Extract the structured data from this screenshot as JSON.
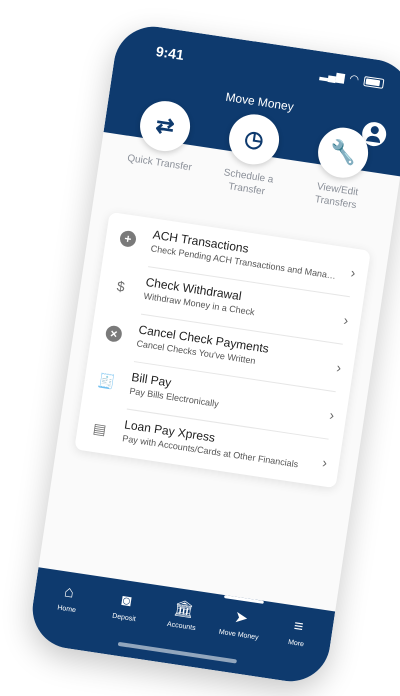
{
  "status": {
    "time": "9:41"
  },
  "header": {
    "title": "Move Money"
  },
  "quick_actions": [
    {
      "label": "Quick Transfer",
      "icon": "transfer-arrows-icon"
    },
    {
      "label": "Schedule a Transfer",
      "icon": "clock-icon"
    },
    {
      "label": "View/Edit Transfers",
      "icon": "wrench-icon"
    }
  ],
  "menu": [
    {
      "title": "ACH Transactions",
      "subtitle": "Check Pending ACH Transactions and Manage A...",
      "icon": "plus-circle-icon"
    },
    {
      "title": "Check Withdrawal",
      "subtitle": "Withdraw Money in a Check",
      "icon": "dollar-icon"
    },
    {
      "title": "Cancel Check Payments",
      "subtitle": "Cancel Checks You've Written",
      "icon": "cancel-circle-icon"
    },
    {
      "title": "Bill Pay",
      "subtitle": "Pay Bills Electronically",
      "icon": "bill-icon"
    },
    {
      "title": "Loan Pay Xpress",
      "subtitle": "Pay with Accounts/Cards at Other Financials",
      "icon": "loan-icon"
    }
  ],
  "tabs": [
    {
      "label": "Home",
      "icon": "home-icon"
    },
    {
      "label": "Deposit",
      "icon": "camera-icon"
    },
    {
      "label": "Accounts",
      "icon": "bank-icon"
    },
    {
      "label": "Move Money",
      "icon": "send-icon",
      "active": true
    },
    {
      "label": "More",
      "icon": "menu-icon"
    }
  ],
  "colors": {
    "primary": "#0e3a6e",
    "background": "#fafafa",
    "card": "#ffffff"
  }
}
